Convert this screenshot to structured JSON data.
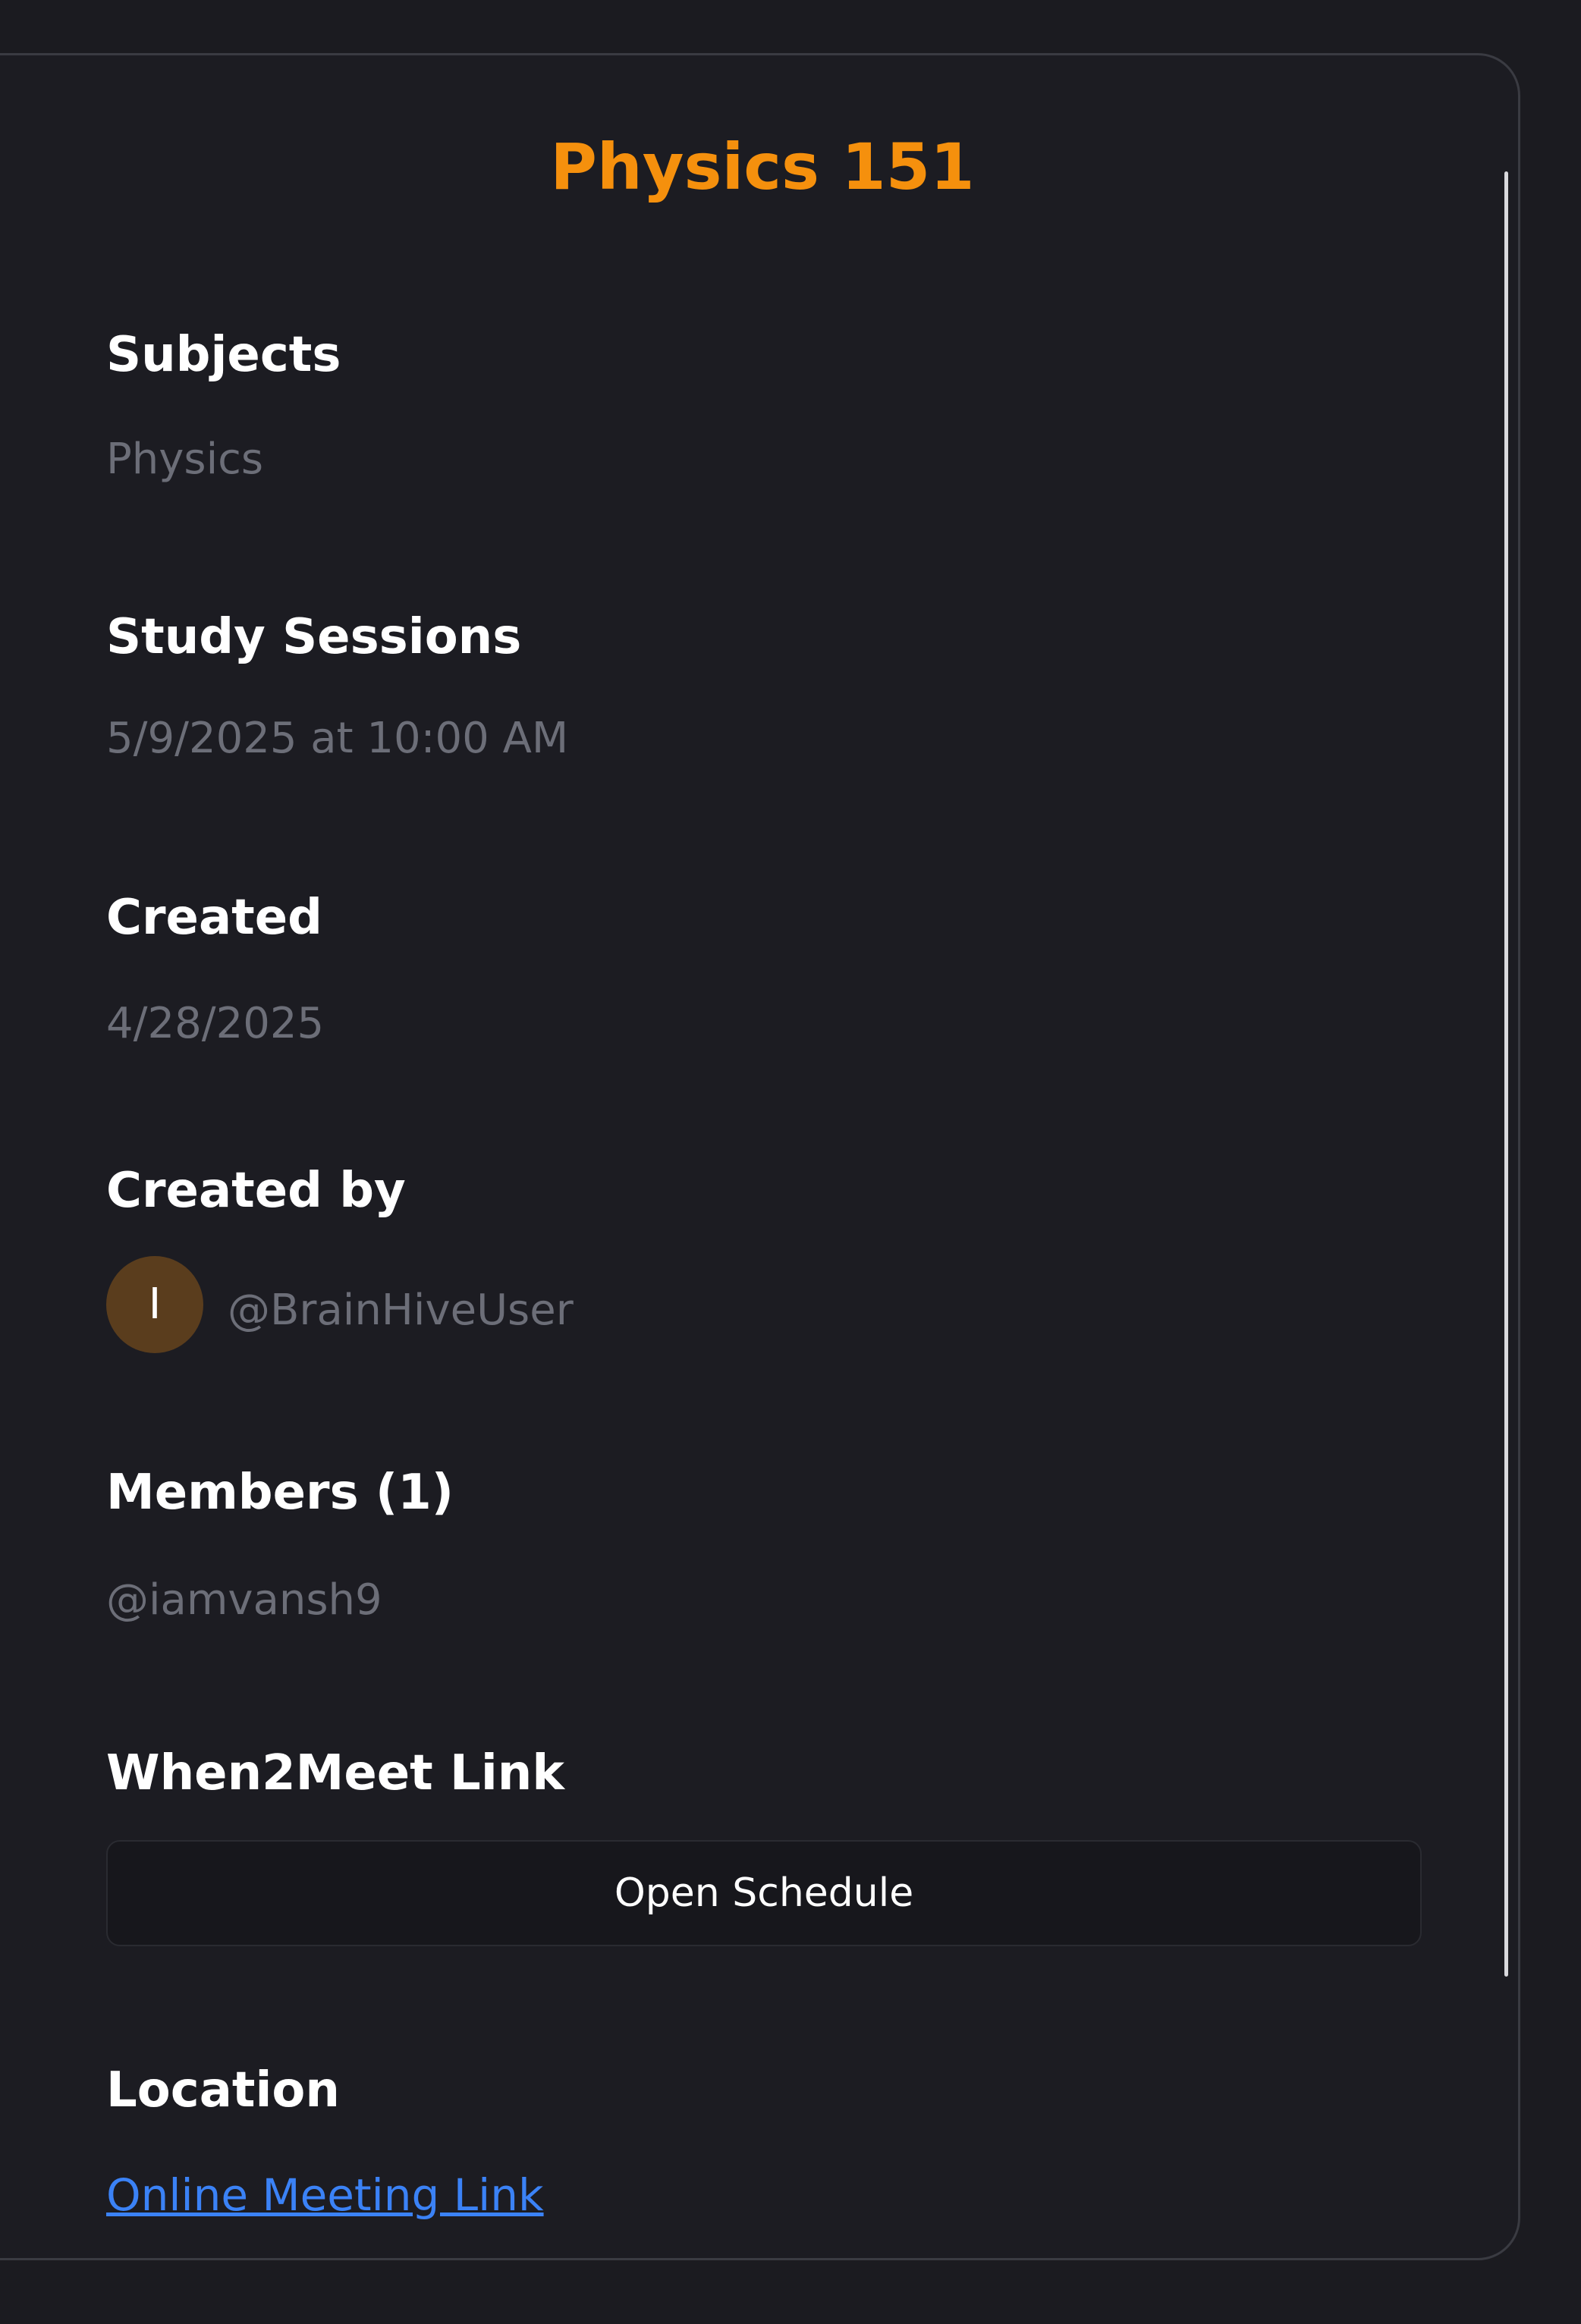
{
  "group": {
    "title": "Physics 151"
  },
  "sections": {
    "subjects": {
      "label": "Subjects",
      "value": "Physics"
    },
    "study_sessions": {
      "label": "Study Sessions",
      "value": "5/9/2025 at 10:00 AM"
    },
    "created": {
      "label": "Created",
      "value": "4/28/2025"
    },
    "created_by": {
      "label": "Created by",
      "avatar_initial": "I",
      "username": "@BrainHiveUser"
    },
    "members": {
      "label": "Members (1)",
      "items": [
        "@iamvansh9"
      ]
    },
    "when2meet": {
      "label": "When2Meet Link",
      "button_label": "Open Schedule"
    },
    "location": {
      "label": "Location",
      "link_text": "Online Meeting Link"
    }
  },
  "colors": {
    "accent": "#f5900d",
    "link": "#3b82f6",
    "background": "#1b1b20",
    "muted_text": "#6c6e78",
    "avatar_bg": "#5a3d1d"
  }
}
